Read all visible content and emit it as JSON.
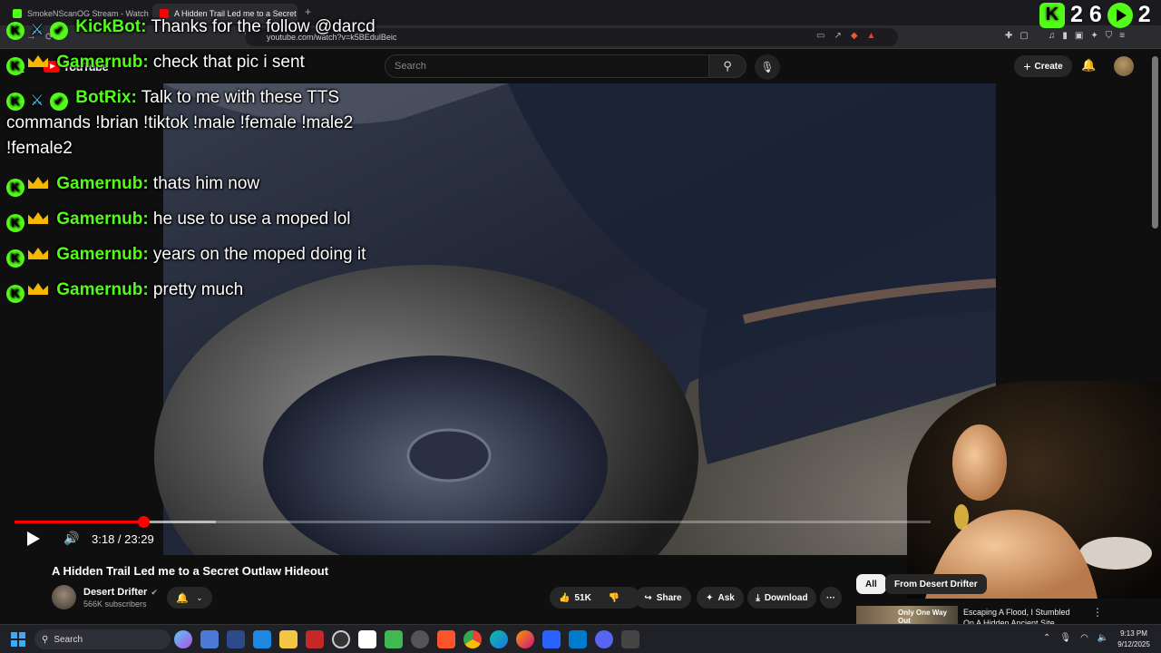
{
  "browser": {
    "tabs": [
      {
        "label": "SmokeNScanOG Stream - Watch Live",
        "favicon_color": "#53fc18"
      },
      {
        "label": "A Hidden Trail Led me to a Secret",
        "favicon_color": "#ff0000"
      }
    ],
    "tab_close": "×",
    "new_tab": "+",
    "url": "youtube.com/watch?v=k5BEdulBeic"
  },
  "youtube": {
    "logo_text": "YouTube",
    "search_placeholder": "Search",
    "create_label": "Create",
    "create_plus": "+"
  },
  "player": {
    "current_time": "3:18",
    "duration": "23:29",
    "time_display": "3:18 / 23:29",
    "progress_fraction": 0.1405,
    "buffered_fraction": 0.22
  },
  "video_info": {
    "title": "A Hidden Trail Led me to a Secret Outlaw Hideout",
    "channel_name": "Desert Drifter",
    "subscribers": "566K subscribers",
    "likes": "51K",
    "share_label": "Share",
    "ask_label": "Ask",
    "download_label": "Download",
    "more_label": "···"
  },
  "recommendations": {
    "chips": [
      "All",
      "From Desert Drifter"
    ],
    "first": {
      "thumb_text": "Only One Way Out",
      "title": "Escaping A Flood, I Stumbled On A Hidden Ancient Site"
    }
  },
  "chat": {
    "top_fragment": "@darcd",
    "messages": [
      {
        "user": "KickBot",
        "badges": [
          "kick",
          "sword",
          "verified"
        ],
        "text": "Thanks for the follow @darcd"
      },
      {
        "user": "Gamernub",
        "badges": [
          "kick",
          "crown"
        ],
        "text": "check that pic i sent"
      },
      {
        "user": "BotRix",
        "badges": [
          "kick",
          "sword",
          "verified"
        ],
        "text": "Talk to me with these TTS commands !brian !tiktok !male !female !male2 !female2"
      },
      {
        "user": "Gamernub",
        "badges": [
          "kick",
          "crown"
        ],
        "text": "thats him now"
      },
      {
        "user": "Gamernub",
        "badges": [
          "kick",
          "crown"
        ],
        "text": "he use to use a moped lol"
      },
      {
        "user": "Gamernub",
        "badges": [
          "kick",
          "crown"
        ],
        "text": "years on the moped doing it"
      },
      {
        "user": "Gamernub",
        "badges": [
          "kick",
          "crown"
        ],
        "text": "pretty much"
      }
    ]
  },
  "overlay_counters": {
    "followers": "2 6",
    "viewers": "2"
  },
  "taskbar": {
    "search_label": "Search",
    "time": "9:13 PM",
    "date": "9/12/2025"
  },
  "colors": {
    "kick_green": "#53fc18",
    "youtube_red": "#ff0000",
    "crown_gold": "#f5b800",
    "background": "#0f0f0f"
  },
  "icons": {
    "kick_badge": "K",
    "verified_badge": "✔",
    "sword_badge": "⚔"
  }
}
